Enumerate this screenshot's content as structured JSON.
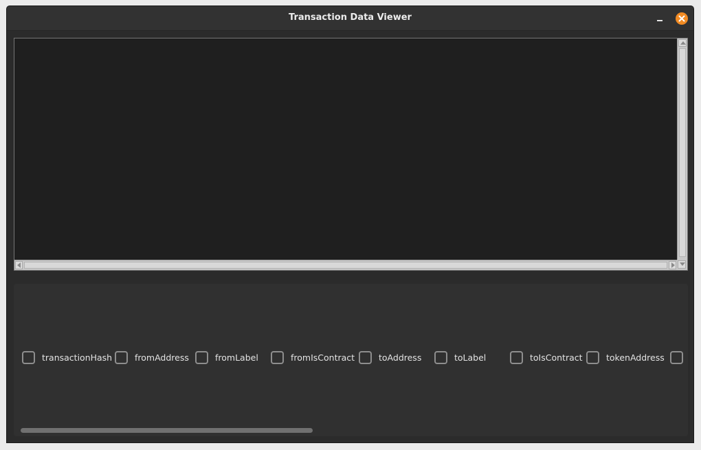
{
  "window": {
    "title": "Transaction Data Viewer"
  },
  "title_buttons": {
    "minimize_icon": "minimize-icon",
    "close_icon": "close-icon",
    "close_color": "#f28b23"
  },
  "text_area": {
    "content": ""
  },
  "columns": [
    {
      "label": "transactionHash",
      "checked": false
    },
    {
      "label": "fromAddress",
      "checked": false
    },
    {
      "label": "fromLabel",
      "checked": false
    },
    {
      "label": "fromIsContract",
      "checked": false
    },
    {
      "label": "toAddress",
      "checked": false
    },
    {
      "label": "toLabel",
      "checked": false
    },
    {
      "label": "toIsContract",
      "checked": false
    },
    {
      "label": "tokenAddress",
      "checked": false
    },
    {
      "label": "",
      "checked": false
    }
  ]
}
